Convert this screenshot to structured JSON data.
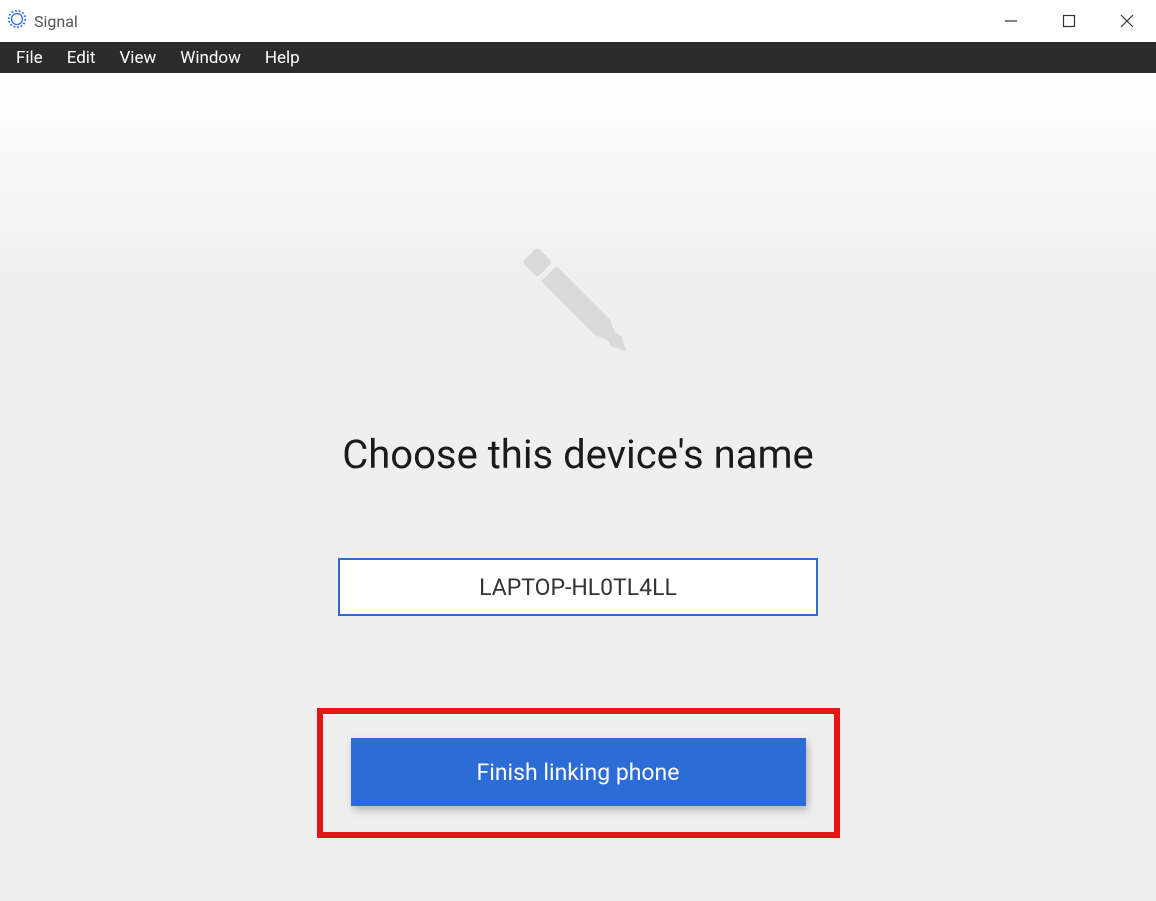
{
  "titlebar": {
    "app_name": "Signal"
  },
  "menubar": {
    "items": [
      "File",
      "Edit",
      "View",
      "Window",
      "Help"
    ]
  },
  "content": {
    "heading": "Choose this device's name",
    "device_name_value": "LAPTOP-HL0TL4LL",
    "finish_button_label": "Finish linking phone"
  },
  "colors": {
    "accent": "#2c6cd6",
    "highlight": "#e51515",
    "menubar_bg": "#2b2b2b"
  }
}
